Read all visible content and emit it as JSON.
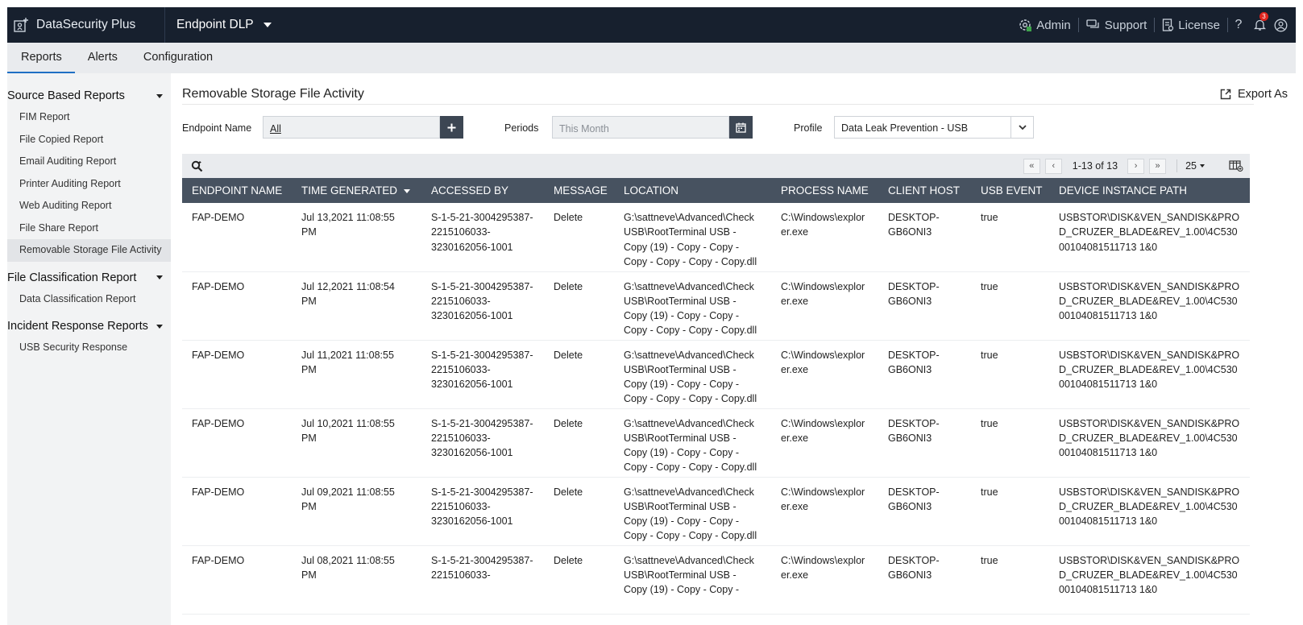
{
  "app": {
    "brand": "DataSecurity Plus",
    "product": "Endpoint DLP",
    "admin_label": "Admin",
    "support_label": "Support",
    "license_label": "License",
    "notification_count": "3"
  },
  "nav": {
    "tabs": [
      "Reports",
      "Alerts",
      "Configuration"
    ],
    "active_tab": "Reports"
  },
  "sidebar": {
    "groups": [
      {
        "title": "Source Based Reports",
        "items": [
          "FIM Report",
          "File Copied Report",
          "Email Auditing Report",
          "Printer Auditing Report",
          "Web Auditing Report",
          "File Share Report",
          "Removable Storage File Activity"
        ]
      },
      {
        "title": "File Classification Report",
        "items": [
          "Data Classification Report"
        ]
      },
      {
        "title": "Incident Response Reports",
        "items": [
          "USB Security Response"
        ]
      }
    ],
    "active_item": "Removable Storage File Activity"
  },
  "report": {
    "title": "Removable Storage File Activity",
    "export_label": "Export As"
  },
  "filters": {
    "endpoint_label": "Endpoint Name",
    "endpoint_value": "All",
    "periods_label": "Periods",
    "periods_value": "This Month",
    "profile_label": "Profile",
    "profile_value": "Data Leak Prevention - USB"
  },
  "pager": {
    "range": "1-13 of 13",
    "page_size": "25"
  },
  "table": {
    "columns": [
      "ENDPOINT NAME",
      "TIME GENERATED",
      "ACCESSED BY",
      "MESSAGE",
      "LOCATION",
      "PROCESS NAME",
      "CLIENT HOST",
      "USB EVENT",
      "DEVICE INSTANCE PATH"
    ],
    "sorted_column": "TIME GENERATED",
    "rows": [
      {
        "endpoint": "FAP-DEMO",
        "time": "Jul 13,2021 11:08:55 PM",
        "accessed_by": "S-1-5-21-3004295387-2215106033-3230162056-1001",
        "message": "Delete",
        "location": "G:\\sattneve\\Advanced\\Check USB\\RootTerminal USB - Copy (19) - Copy - Copy - Copy - Copy - Copy - Copy.dll",
        "process": "C:\\Windows\\explorer.exe",
        "client_host": "DESKTOP-GB6ONI3",
        "usb_event": "true",
        "device_path": "USBSTOR\\DISK&VEN_SANDISK&PROD_CRUZER_BLADE&REV_1.00\\4C53000104081511713 1&0"
      },
      {
        "endpoint": "FAP-DEMO",
        "time": "Jul 12,2021 11:08:54 PM",
        "accessed_by": "S-1-5-21-3004295387-2215106033-3230162056-1001",
        "message": "Delete",
        "location": "G:\\sattneve\\Advanced\\Check USB\\RootTerminal USB - Copy (19) - Copy - Copy - Copy - Copy - Copy - Copy.dll",
        "process": "C:\\Windows\\explorer.exe",
        "client_host": "DESKTOP-GB6ONI3",
        "usb_event": "true",
        "device_path": "USBSTOR\\DISK&VEN_SANDISK&PROD_CRUZER_BLADE&REV_1.00\\4C53000104081511713 1&0"
      },
      {
        "endpoint": "FAP-DEMO",
        "time": "Jul 11,2021 11:08:55 PM",
        "accessed_by": "S-1-5-21-3004295387-2215106033-3230162056-1001",
        "message": "Delete",
        "location": "G:\\sattneve\\Advanced\\Check USB\\RootTerminal USB - Copy (19) - Copy - Copy - Copy - Copy - Copy - Copy.dll",
        "process": "C:\\Windows\\explorer.exe",
        "client_host": "DESKTOP-GB6ONI3",
        "usb_event": "true",
        "device_path": "USBSTOR\\DISK&VEN_SANDISK&PROD_CRUZER_BLADE&REV_1.00\\4C53000104081511713 1&0"
      },
      {
        "endpoint": "FAP-DEMO",
        "time": "Jul 10,2021 11:08:55 PM",
        "accessed_by": "S-1-5-21-3004295387-2215106033-3230162056-1001",
        "message": "Delete",
        "location": "G:\\sattneve\\Advanced\\Check USB\\RootTerminal USB - Copy (19) - Copy - Copy - Copy - Copy - Copy - Copy.dll",
        "process": "C:\\Windows\\explorer.exe",
        "client_host": "DESKTOP-GB6ONI3",
        "usb_event": "true",
        "device_path": "USBSTOR\\DISK&VEN_SANDISK&PROD_CRUZER_BLADE&REV_1.00\\4C53000104081511713 1&0"
      },
      {
        "endpoint": "FAP-DEMO",
        "time": "Jul 09,2021 11:08:55 PM",
        "accessed_by": "S-1-5-21-3004295387-2215106033-3230162056-1001",
        "message": "Delete",
        "location": "G:\\sattneve\\Advanced\\Check USB\\RootTerminal USB - Copy (19) - Copy - Copy - Copy - Copy - Copy - Copy.dll",
        "process": "C:\\Windows\\explorer.exe",
        "client_host": "DESKTOP-GB6ONI3",
        "usb_event": "true",
        "device_path": "USBSTOR\\DISK&VEN_SANDISK&PROD_CRUZER_BLADE&REV_1.00\\4C53000104081511713 1&0"
      },
      {
        "endpoint": "FAP-DEMO",
        "time": "Jul 08,2021 11:08:55 PM",
        "accessed_by": "S-1-5-21-3004295387-2215106033-",
        "message": "Delete",
        "location": "G:\\sattneve\\Advanced\\Check USB\\RootTerminal USB - Copy (19) - Copy - Copy -",
        "process": "C:\\Windows\\explorer.exe",
        "client_host": "DESKTOP-GB6ONI3",
        "usb_event": "true",
        "device_path": "USBSTOR\\DISK&VEN_SANDISK&PROD_CRUZER_BLADE&REV_1.00\\4C53000104081511713 1&0"
      }
    ]
  },
  "colors": {
    "topbar": "#17202e",
    "header_row": "#475260",
    "accent": "#1f6fc4",
    "notification": "#e0231c"
  }
}
